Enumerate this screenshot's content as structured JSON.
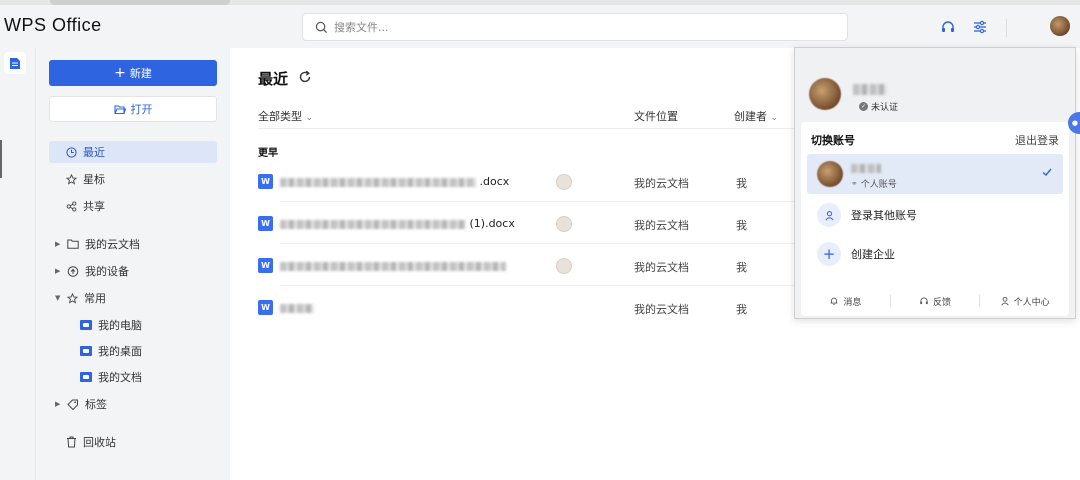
{
  "app": {
    "logo": "WPS Office"
  },
  "search": {
    "placeholder": "搜索文件..."
  },
  "sidebar": {
    "new_label": "新建",
    "open_label": "打开",
    "nav": [
      {
        "label": "最近"
      },
      {
        "label": "星标"
      },
      {
        "label": "共享"
      }
    ],
    "tree": [
      {
        "label": "我的云文档"
      },
      {
        "label": "我的设备"
      },
      {
        "label": "常用"
      }
    ],
    "common_children": [
      {
        "label": "我的电脑"
      },
      {
        "label": "我的桌面"
      },
      {
        "label": "我的文档"
      }
    ],
    "tags_label": "标签",
    "trash_label": "回收站"
  },
  "main": {
    "title": "最近",
    "columns": {
      "type": "全部类型",
      "location": "文件位置",
      "creator": "创建者"
    },
    "group_label": "更早",
    "files": [
      {
        "icon": "W",
        "name_suffix": ".docx",
        "location": "我的云文档",
        "creator": "我"
      },
      {
        "icon": "W",
        "name_suffix": "(1).docx",
        "location": "我的云文档",
        "creator": "我"
      },
      {
        "icon": "W",
        "name_suffix": "",
        "location": "我的云文档",
        "creator": "我"
      },
      {
        "icon": "W",
        "name_suffix": "",
        "location": "我的云文档",
        "creator": "我"
      }
    ]
  },
  "account_popup": {
    "status": "未认证",
    "switch_label": "切换账号",
    "logout_label": "退出登录",
    "current_account_type": "个人账号",
    "login_other_label": "登录其他账号",
    "create_enterprise_label": "创建企业",
    "footer": [
      {
        "label": "消息"
      },
      {
        "label": "反馈"
      },
      {
        "label": "个人中心"
      }
    ]
  },
  "colors": {
    "accent": "#2f64e0",
    "selected_bg": "#dde6f7",
    "word_blue": "#3a6ef0"
  },
  "icons": [
    "search-icon",
    "headset-icon",
    "settings-sliders-icon",
    "doc-icon",
    "plus-icon",
    "folder-open-icon",
    "clock-icon",
    "star-icon",
    "share-icon",
    "folder-icon",
    "cloud-upload-icon",
    "tag-icon",
    "trash-icon",
    "refresh-icon",
    "check-icon",
    "user-icon",
    "bell-icon"
  ]
}
